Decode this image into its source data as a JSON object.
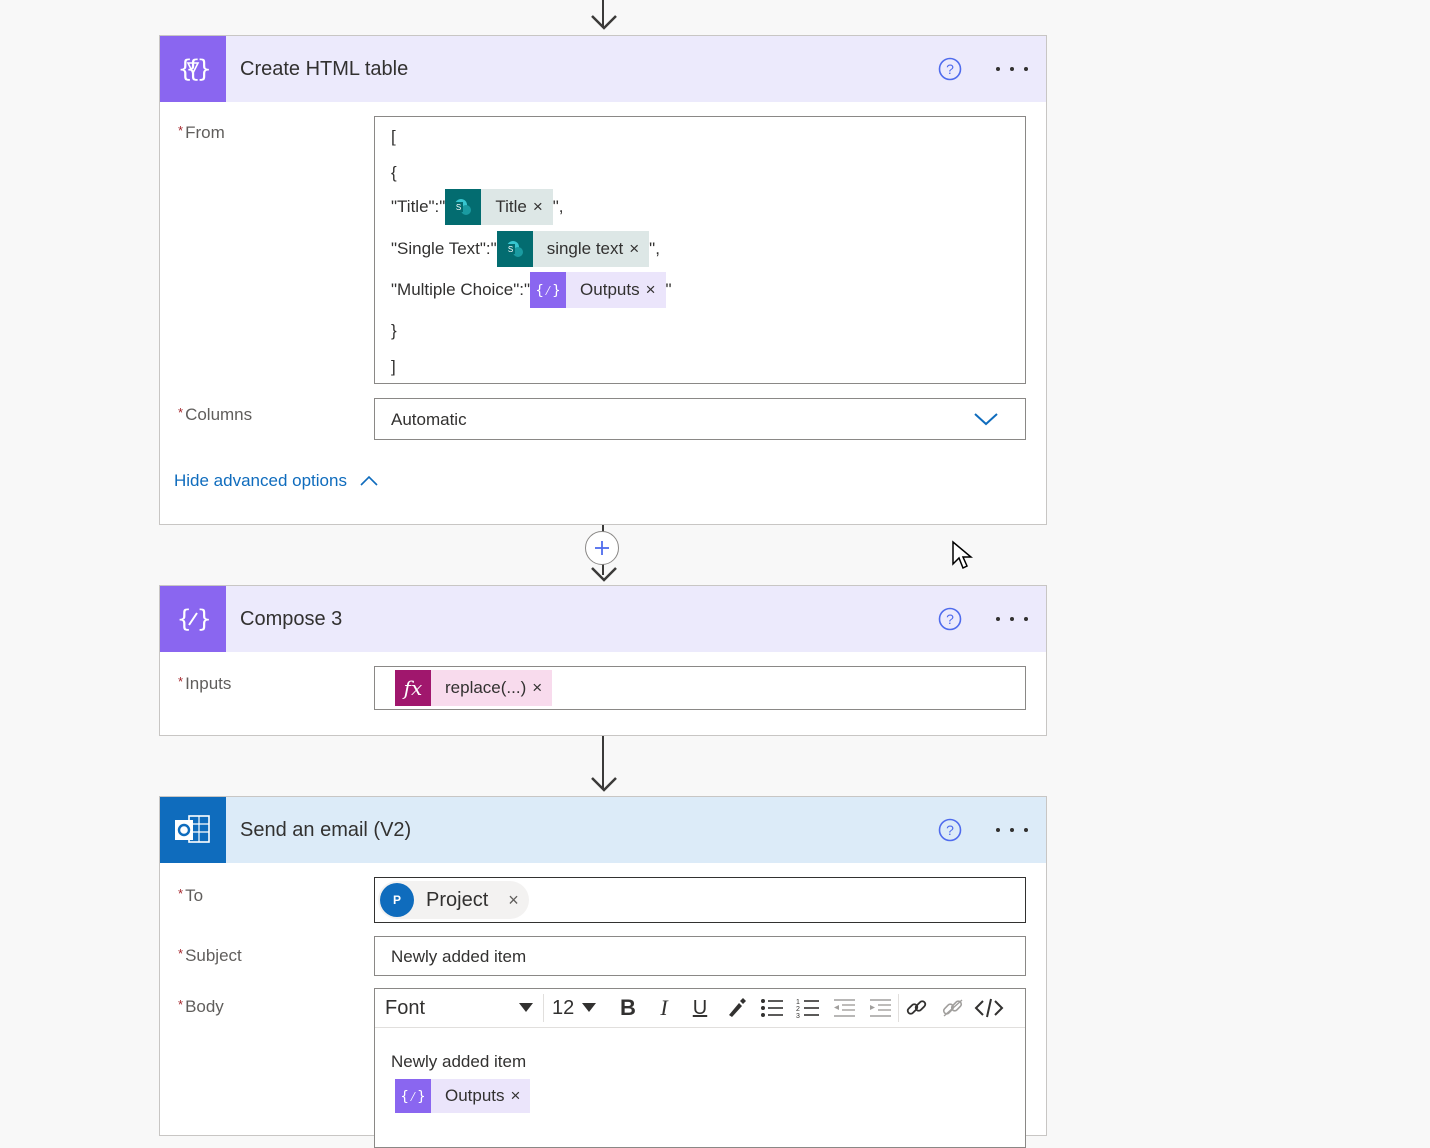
{
  "create_html_table": {
    "title": "Create HTML table",
    "from_label": "From",
    "from_lines": {
      "l1": "[",
      "l2": "{",
      "l3_prefix": "\"Title\":\"",
      "l3_token": "Title",
      "l3_suffix": "\",",
      "l4_prefix": "\"Single Text\":\"",
      "l4_token": "single text",
      "l4_suffix": "\",",
      "l5_prefix": "\"Multiple Choice\":\"",
      "l5_token": "Outputs",
      "l5_suffix": "\"",
      "l6": "}",
      "l7": "]"
    },
    "columns_label": "Columns",
    "columns_value": "Automatic",
    "hide_advanced": "Hide advanced options"
  },
  "compose3": {
    "title": "Compose 3",
    "inputs_label": "Inputs",
    "inputs_token": "replace(...)"
  },
  "send_email": {
    "title": "Send an email (V2)",
    "to_label": "To",
    "to_initial": "P",
    "to_value": "Project",
    "subject_label": "Subject",
    "subject_value": "Newly added item",
    "body_label": "Body",
    "toolbar": {
      "font": "Font",
      "size": "12"
    },
    "body_text": "Newly added item",
    "body_token": "Outputs"
  },
  "common": {
    "required": "*",
    "remove": "×",
    "fx": "fx"
  },
  "colors": {
    "action_purple": "#8a66f0",
    "outlook_blue": "#0f6cbd",
    "sharepoint_teal": "#036c70",
    "expression_magenta": "#a0176d"
  }
}
